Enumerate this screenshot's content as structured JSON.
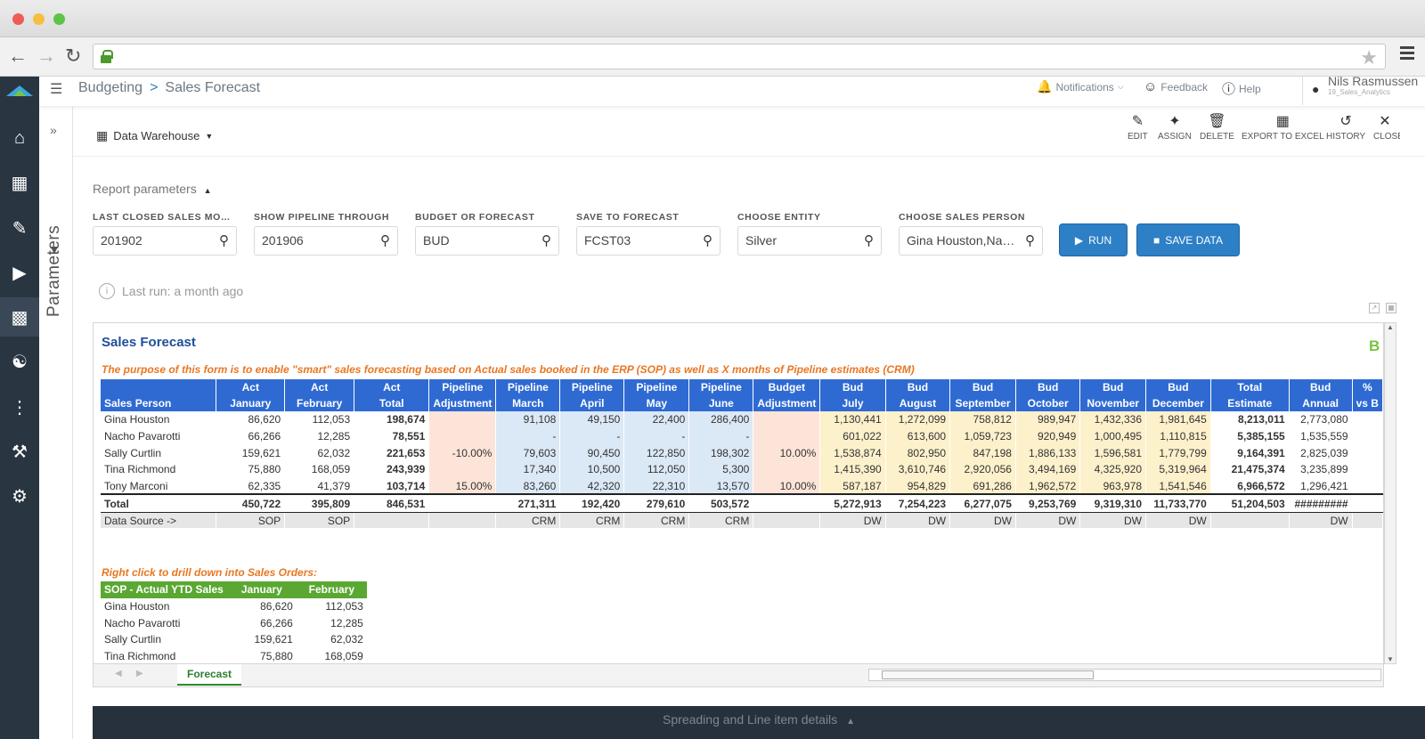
{
  "breadcrumb": {
    "parent": "Budgeting",
    "separator": ">",
    "current": "Sales Forecast"
  },
  "header": {
    "notifications": "Notifications",
    "feedback": "Feedback",
    "help": "Help",
    "user_name": "Nils Rasmussen",
    "user_role": "19_Sales_Analytics"
  },
  "params_panel": {
    "label": "Parameters"
  },
  "data_source_selector": {
    "label": "Data Warehouse"
  },
  "toolbar": {
    "edit": "EDIT",
    "assign": "ASSIGN",
    "delete": "DELETE",
    "export": "EXPORT TO EXCEL",
    "history": "HISTORY",
    "close": "CLOSE"
  },
  "report_params": {
    "title": "Report parameters",
    "fields": [
      {
        "label": "LAST CLOSED SALES MON...",
        "value": "201902"
      },
      {
        "label": "SHOW PIPELINE THROUGH",
        "value": "201906"
      },
      {
        "label": "BUDGET OR FORECAST",
        "value": "BUD"
      },
      {
        "label": "SAVE TO FORECAST",
        "value": "FCST03"
      },
      {
        "label": "CHOOSE ENTITY",
        "value": "Silver"
      },
      {
        "label": "CHOOSE SALES PERSON",
        "value": "Gina Houston,Nac..."
      }
    ],
    "run_label": "RUN",
    "save_label": "SAVE DATA",
    "last_run": "Last run: a month ago"
  },
  "sheet": {
    "title": "Sales  Forecast",
    "corner_letter": "B",
    "purpose": "The purpose of this form is to enable \"smart\" sales forecasting based on Actual sales booked in the ERP (SOP) as well as X months of Pipeline estimates (CRM)",
    "header_row1": [
      "",
      "Act",
      "Act",
      "Act",
      "Pipeline",
      "Pipeline",
      "Pipeline",
      "Pipeline",
      "Pipeline",
      "Budget",
      "Bud",
      "Bud",
      "Bud",
      "Bud",
      "Bud",
      "Bud",
      "Total",
      "Bud",
      "%"
    ],
    "header_row2": [
      "Sales Person",
      "January",
      "February",
      "Total",
      "Adjustment",
      "March",
      "April",
      "May",
      "June",
      "Adjustment",
      "July",
      "August",
      "September",
      "October",
      "November",
      "December",
      "Estimate",
      "Annual",
      "vs B"
    ],
    "rows": [
      [
        "Gina Houston",
        "86,620",
        "112,053",
        "198,674",
        "",
        "91,108",
        "49,150",
        "22,400",
        "286,400",
        "",
        "1,130,441",
        "1,272,099",
        "758,812",
        "989,947",
        "1,432,336",
        "1,981,645",
        "8,213,011",
        "2,773,080",
        ""
      ],
      [
        "Nacho Pavarotti",
        "66,266",
        "12,285",
        "78,551",
        "",
        "-",
        "-",
        "-",
        "-",
        "",
        "601,022",
        "613,600",
        "1,059,723",
        "920,949",
        "1,000,495",
        "1,110,815",
        "5,385,155",
        "1,535,559",
        ""
      ],
      [
        "Sally Curtlin",
        "159,621",
        "62,032",
        "221,653",
        "-10.00%",
        "79,603",
        "90,450",
        "122,850",
        "198,302",
        "10.00%",
        "1,538,874",
        "802,950",
        "847,198",
        "1,886,133",
        "1,596,581",
        "1,779,799",
        "9,164,391",
        "2,825,039",
        ""
      ],
      [
        "Tina Richmond",
        "75,880",
        "168,059",
        "243,939",
        "",
        "17,340",
        "10,500",
        "112,050",
        "5,300",
        "",
        "1,415,390",
        "3,610,746",
        "2,920,056",
        "3,494,169",
        "4,325,920",
        "5,319,964",
        "21,475,374",
        "3,235,899",
        ""
      ],
      [
        "Tony Marconi",
        "62,335",
        "41,379",
        "103,714",
        "15.00%",
        "83,260",
        "42,320",
        "22,310",
        "13,570",
        "10.00%",
        "587,187",
        "954,829",
        "691,286",
        "1,962,572",
        "963,978",
        "1,541,546",
        "6,966,572",
        "1,296,421",
        ""
      ]
    ],
    "total_row": [
      "Total",
      "450,722",
      "395,809",
      "846,531",
      "",
      "271,311",
      "192,420",
      "279,610",
      "503,572",
      "",
      "5,272,913",
      "7,254,223",
      "6,277,075",
      "9,253,769",
      "9,319,310",
      "11,733,770",
      "51,204,503",
      "#########",
      ""
    ],
    "source_row": [
      "Data Source ->",
      "SOP",
      "SOP",
      "",
      "",
      "CRM",
      "CRM",
      "CRM",
      "CRM",
      "",
      "DW",
      "DW",
      "DW",
      "DW",
      "DW",
      "DW",
      "",
      "DW",
      ""
    ],
    "drill_note": "Right click to drill down into Sales Orders:",
    "sop_header": [
      "SOP - Actual YTD Sales",
      "January",
      "February"
    ],
    "sop_rows": [
      [
        "Gina Houston",
        "86,620",
        "112,053"
      ],
      [
        "Nacho Pavarotti",
        "66,266",
        "12,285"
      ],
      [
        "Sally Curtlin",
        "159,621",
        "62,032"
      ],
      [
        "Tina Richmond",
        "75,880",
        "168,059"
      ]
    ],
    "tab": "Forecast"
  },
  "bottom_panel": {
    "label": "Spreading and Line item details"
  }
}
